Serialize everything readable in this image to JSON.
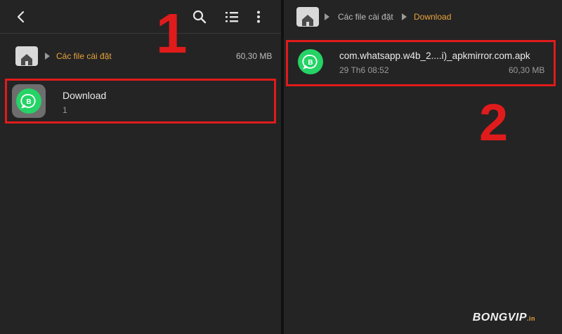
{
  "left": {
    "breadcrumb": {
      "folder": "Các file cài đặt",
      "size": "60,30 MB"
    },
    "item": {
      "title": "Download",
      "subtitle": "1"
    },
    "step_label": "1"
  },
  "right": {
    "breadcrumb": {
      "folder": "Các file cài đặt",
      "current": "Download"
    },
    "file": {
      "name": "com.whatsapp.w4b_2....i)_apkmirror.com.apk",
      "date": "29 Th6 08:52",
      "size": "60,30 MB"
    },
    "step_label": "2"
  },
  "watermark": {
    "text": "BONGVIP",
    "suffix": ".in"
  },
  "icons": {
    "back": "chevron-left-icon",
    "search": "search-icon",
    "view": "list-view-icon",
    "more": "more-vert-icon",
    "home": "home-icon",
    "app": "whatsapp-business-icon"
  },
  "colors": {
    "highlight": "#e01b1b",
    "active_crumb": "#e8a33c",
    "whatsapp_green": "#25d366",
    "background": "#242424"
  }
}
